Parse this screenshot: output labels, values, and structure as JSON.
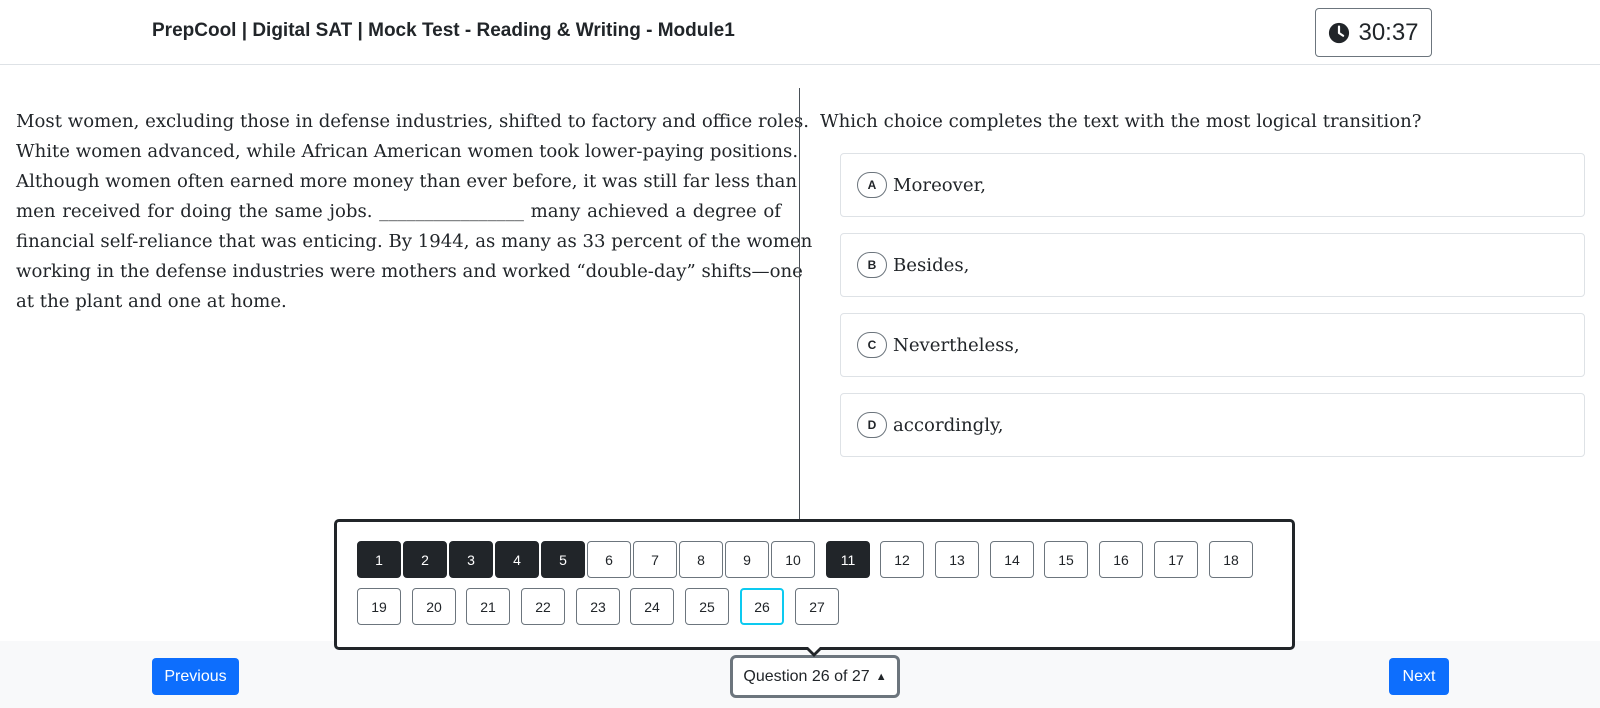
{
  "header": {
    "title": "PrepCool | Digital SAT | Mock Test - Reading & Writing - Module1",
    "timer": "30:37",
    "timer_icon": "clock-icon"
  },
  "passage": {
    "lines": [
      "Most women, excluding those in defense industries, shifted to factory and office roles.",
      "White women advanced, while African American women took lower-paying positions.",
      "Although women often earned more money than ever before, it was still far less than",
      "men received for doing the same jobs. ________________ many achieved a degree of",
      "financial self-reliance that was enticing. By 1944, as many as 33 percent of the women",
      "working in the defense industries were mothers and worked “double-day” shifts—one",
      "at the plant and one at home."
    ]
  },
  "question": {
    "prompt": "Which choice completes the text with the most logical transition?",
    "choices": [
      {
        "letter": "A",
        "text": "Moreover,"
      },
      {
        "letter": "B",
        "text": "Besides,"
      },
      {
        "letter": "C",
        "text": "Nevertheless,"
      },
      {
        "letter": "D",
        "text": "accordingly,"
      }
    ]
  },
  "navigator": {
    "total": 27,
    "current": 26,
    "answered": [
      1,
      2,
      3,
      4,
      5,
      11
    ],
    "labels": [
      "1",
      "2",
      "3",
      "4",
      "5",
      "6",
      "7",
      "8",
      "9",
      "10",
      "11",
      "12",
      "13",
      "14",
      "15",
      "16",
      "17",
      "18",
      "19",
      "20",
      "21",
      "22",
      "23",
      "24",
      "25",
      "26",
      "27"
    ]
  },
  "footer": {
    "previous_label": "Previous",
    "next_label": "Next",
    "question_indicator": "Question 26 of 27",
    "caret": "▲"
  },
  "colors": {
    "primary": "#0d6efd",
    "answered": "#212529",
    "current_outline": "#0dcaf0"
  }
}
